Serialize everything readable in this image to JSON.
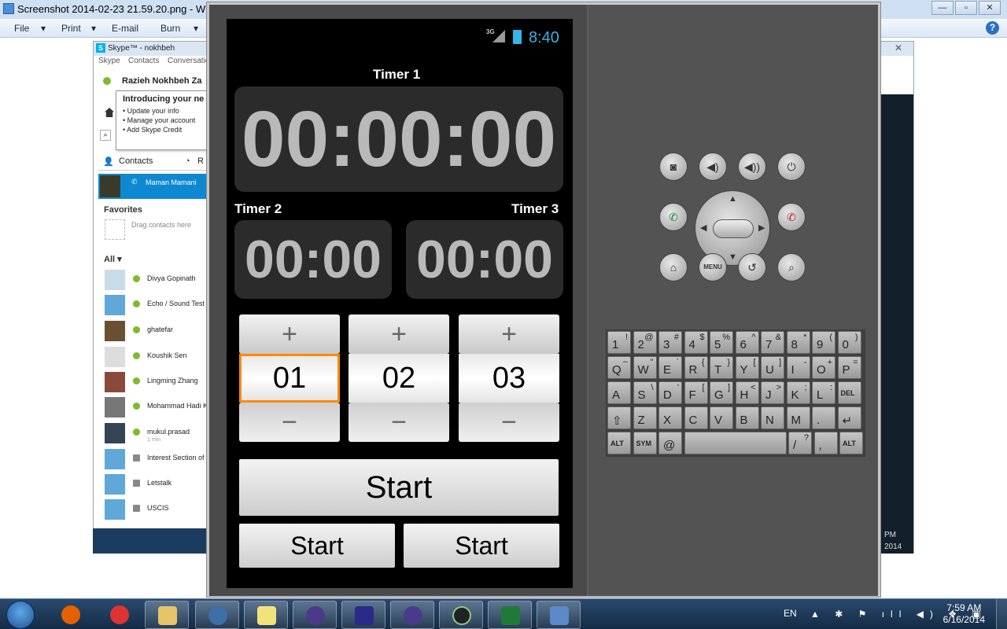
{
  "photo_viewer": {
    "title": "Screenshot 2014-02-23 21.59.20.png - Windo",
    "menu": [
      "File",
      "Print",
      "E-mail",
      "Burn"
    ],
    "help": "?"
  },
  "skype": {
    "title": "Skype™ - nokhbeh",
    "close": "✕",
    "menu": [
      "Skype",
      "Contacts",
      "Conversatio"
    ],
    "user": "Razieh Nokhbeh Za",
    "tooltip": {
      "heading": "Introducing your ne",
      "bullets": [
        "Update your info",
        "Manage your account",
        "Add Skype Credit"
      ]
    },
    "tabs": [
      "Contacts",
      "R"
    ],
    "selected_contact": "Maman Mamani",
    "favorites_label": "Favorites",
    "drag_text": "Drag contacts here",
    "all_label": "All ▾",
    "contacts": [
      {
        "name": "Divya Gopinath",
        "sub": ""
      },
      {
        "name": "Echo / Sound Test",
        "sub": ""
      },
      {
        "name": "ghatefar",
        "sub": ""
      },
      {
        "name": "Koushik Sen",
        "sub": ""
      },
      {
        "name": "Lingming Zhang",
        "sub": ""
      },
      {
        "name": "Mohammad Hadi Ke",
        "sub": ""
      },
      {
        "name": "mukul.prasad",
        "sub": "1 min"
      },
      {
        "name": "Interest Section of",
        "sub": ""
      },
      {
        "name": "Letstalk",
        "sub": ""
      },
      {
        "name": "USCIS",
        "sub": ""
      }
    ],
    "right_pm": "PM",
    "right_year": "2014"
  },
  "android": {
    "network": "3G",
    "time": "8:40",
    "timer1_label": "Timer 1",
    "timer1_value": "00:00:00",
    "timer2_label": "Timer 2",
    "timer2_value": "00:00",
    "timer3_label": "Timer 3",
    "timer3_value": "00:00",
    "pickers": [
      {
        "plus": "+",
        "value": "01",
        "minus": "−"
      },
      {
        "plus": "+",
        "value": "02",
        "minus": "−"
      },
      {
        "plus": "+",
        "value": "03",
        "minus": "−"
      }
    ],
    "start_main": "Start",
    "start_left": "Start",
    "start_right": "Start"
  },
  "emulator": {
    "menu_label": "MENU",
    "keyboard": [
      [
        [
          "1",
          "!"
        ],
        [
          "2",
          "@"
        ],
        [
          "3",
          "#"
        ],
        [
          "4",
          "$"
        ],
        [
          "5",
          "%"
        ],
        [
          "6",
          "^"
        ],
        [
          "7",
          "&"
        ],
        [
          "8",
          "*"
        ],
        [
          "9",
          "("
        ],
        [
          "0",
          ")"
        ]
      ],
      [
        [
          "Q",
          "~"
        ],
        [
          "W",
          "\""
        ],
        [
          "E",
          "`"
        ],
        [
          "R",
          "{"
        ],
        [
          "T",
          "}"
        ],
        [
          "Y",
          "["
        ],
        [
          "U",
          "]"
        ],
        [
          "I",
          "-"
        ],
        [
          "O",
          "+"
        ],
        [
          "P",
          "="
        ]
      ],
      [
        [
          "A",
          ""
        ],
        [
          "S",
          "\\"
        ],
        [
          "D",
          "'"
        ],
        [
          "F",
          "["
        ],
        [
          "G",
          "]"
        ],
        [
          "H",
          "<"
        ],
        [
          "J",
          ">"
        ],
        [
          "K",
          ";"
        ],
        [
          "L",
          ":"
        ],
        [
          "DEL",
          ""
        ]
      ],
      [
        [
          "⇧",
          ""
        ],
        [
          "Z",
          ""
        ],
        [
          "X",
          ""
        ],
        [
          "C",
          ""
        ],
        [
          "V",
          ""
        ],
        [
          "B",
          ""
        ],
        [
          "N",
          ""
        ],
        [
          "M",
          ""
        ],
        [
          ".",
          ""
        ],
        [
          "↵",
          ""
        ]
      ],
      [
        [
          "ALT",
          ""
        ],
        [
          "SYM",
          ""
        ],
        [
          "@",
          ""
        ],
        [
          "",
          ""
        ],
        [
          "/",
          "?"
        ],
        [
          ",",
          ""
        ],
        [
          "ALT",
          ""
        ]
      ]
    ]
  },
  "taskbar": {
    "lang": "EN",
    "time": "7:59 AM",
    "date": "6/16/2014",
    "tray_icons": "▲ ✱ ⚑ ıll ◀) ❖ ▣"
  }
}
